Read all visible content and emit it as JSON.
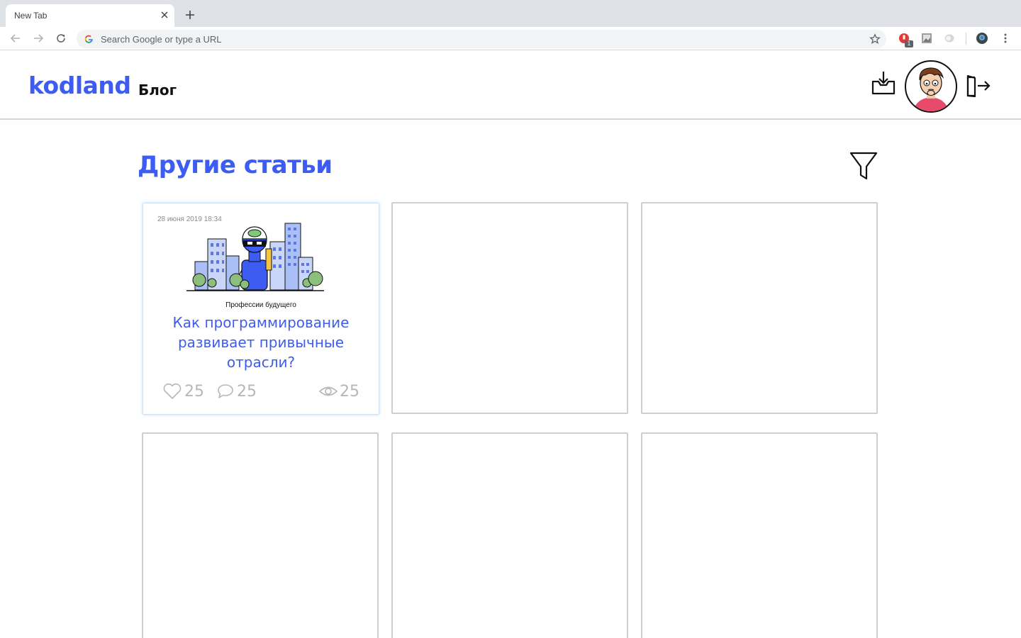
{
  "browser": {
    "tab_title": "New Tab",
    "omnibox_placeholder": "Search Google or type a URL",
    "extension_badge": "1"
  },
  "header": {
    "logo": "kodland",
    "nav_blog": "Блог"
  },
  "main": {
    "section_title": "Другие статьи",
    "featured_card": {
      "date": "28 июня 2019 18:34",
      "tag": "Профессии будущего",
      "title": "Как программирование развивает привычные отрасли?",
      "likes": "25",
      "comments": "25",
      "views": "25"
    }
  },
  "colors": {
    "accent": "#3d5cf1",
    "muted": "#b7b7b7",
    "card_border": "#cfcfcf"
  }
}
